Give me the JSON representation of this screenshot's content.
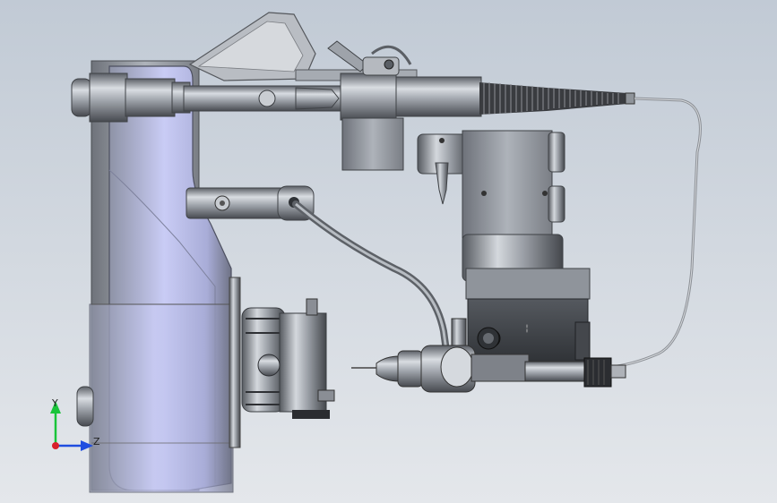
{
  "triad": {
    "y_label": "Y",
    "z_label": "Z",
    "y_color": "#19c43a",
    "z_color": "#1f4de0",
    "x_color": "#d8202a"
  },
  "colors": {
    "bg_top": "#c3ccd6",
    "bg_bottom": "#e2e6ea",
    "metal_dark": "#54585e",
    "metal_mid": "#9aa0a8",
    "metal_light": "#d7dbe0",
    "body_blue": "#b8bdf0"
  }
}
